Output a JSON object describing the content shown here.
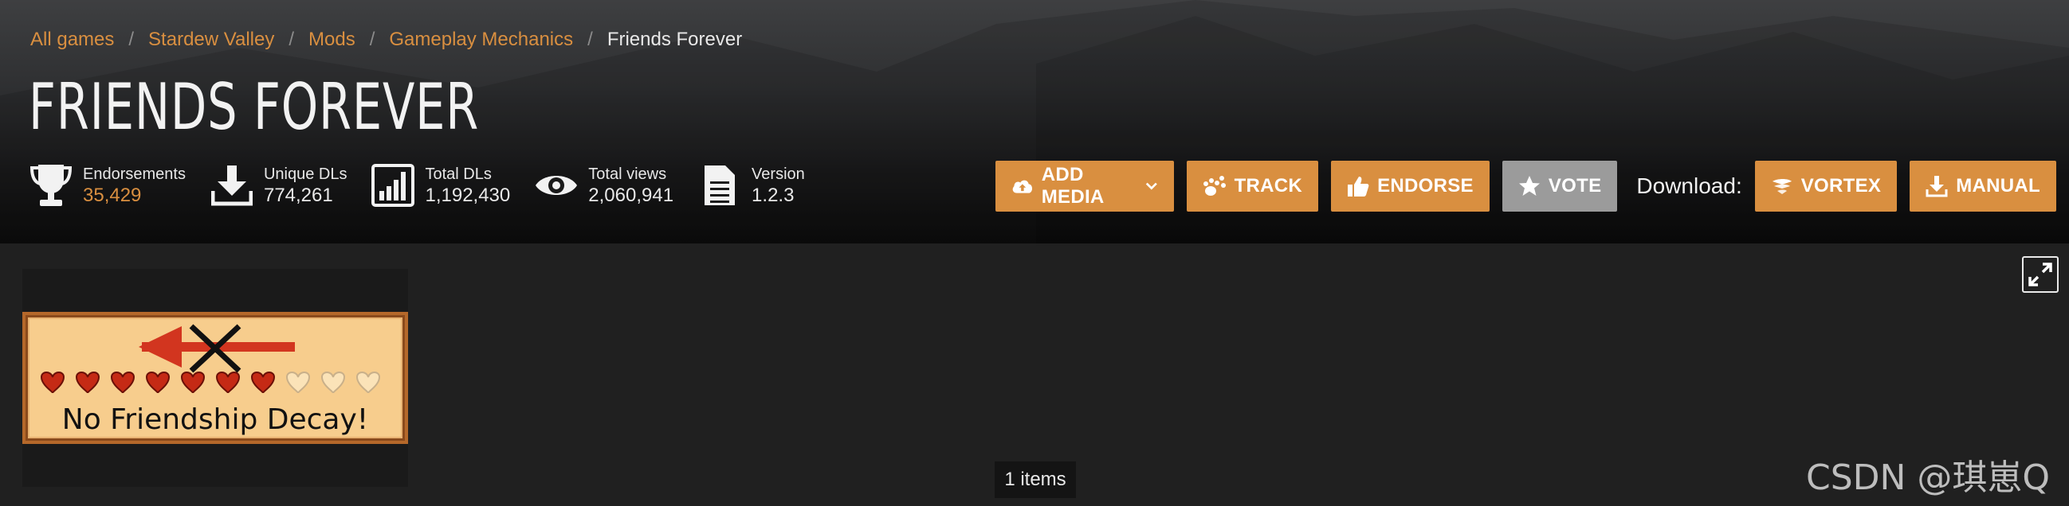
{
  "breadcrumb": {
    "items": [
      "All games",
      "Stardew Valley",
      "Mods",
      "Gameplay Mechanics"
    ],
    "current": "Friends Forever"
  },
  "title": "FRIENDS FOREVER",
  "stats": [
    {
      "label": "Endorsements",
      "value": "35,429",
      "icon": "trophy-icon"
    },
    {
      "label": "Unique DLs",
      "value": "774,261",
      "icon": "download-icon"
    },
    {
      "label": "Total DLs",
      "value": "1,192,430",
      "icon": "bar-chart-icon"
    },
    {
      "label": "Total views",
      "value": "2,060,941",
      "icon": "eye-icon"
    },
    {
      "label": "Version",
      "value": "1.2.3",
      "icon": "document-icon"
    }
  ],
  "actions": {
    "add_media": "ADD MEDIA",
    "track": "TRACK",
    "endorse": "ENDORSE",
    "vote": "VOTE",
    "download_label": "Download:",
    "vortex": "VORTEX",
    "manual": "MANUAL"
  },
  "gallery": {
    "thumb_caption": "No Friendship Decay!",
    "hearts_filled": 7,
    "hearts_total": 10,
    "items_count": "1 items"
  },
  "watermark": "CSDN @琪崽Q",
  "colors": {
    "accent": "#d98f40",
    "vote_grey": "#9b9b9b",
    "background": "#202020"
  }
}
